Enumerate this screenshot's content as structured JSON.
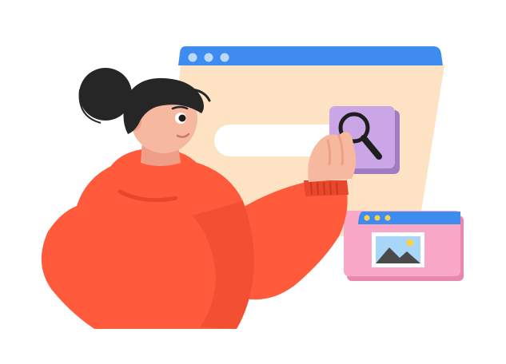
{
  "illustration": {
    "subject": "woman-using-search",
    "elements": {
      "browser_window": {
        "icon": "browser-window-icon"
      },
      "search_button": {
        "icon": "magnifier-icon"
      },
      "image_card": {
        "icon": "image-icon"
      }
    }
  },
  "colors": {
    "browser_titlebar": "#3f8cf0",
    "browser_body": "#fde3c4",
    "window_dot": "#bcd8fb",
    "search_field": "#ffffff",
    "search_button": "#caa6e6",
    "search_button_shadow": "#9f7bc4",
    "magnifier": "#1e1e1e",
    "hoodie": "#ff5a3c",
    "hoodie_shade": "#e8472b",
    "skin": "#f7b8a0",
    "skin_shade": "#ef9f88",
    "hair": "#262626",
    "card_body": "#f9a8c8",
    "card_shadow": "#ea87ae",
    "card_titlebar": "#3f8cf0",
    "card_dot": "#f9d24a",
    "photo_sky": "#a7d6f9",
    "photo_sun": "#f9d24a",
    "photo_mountain": "#4a4a4a"
  }
}
